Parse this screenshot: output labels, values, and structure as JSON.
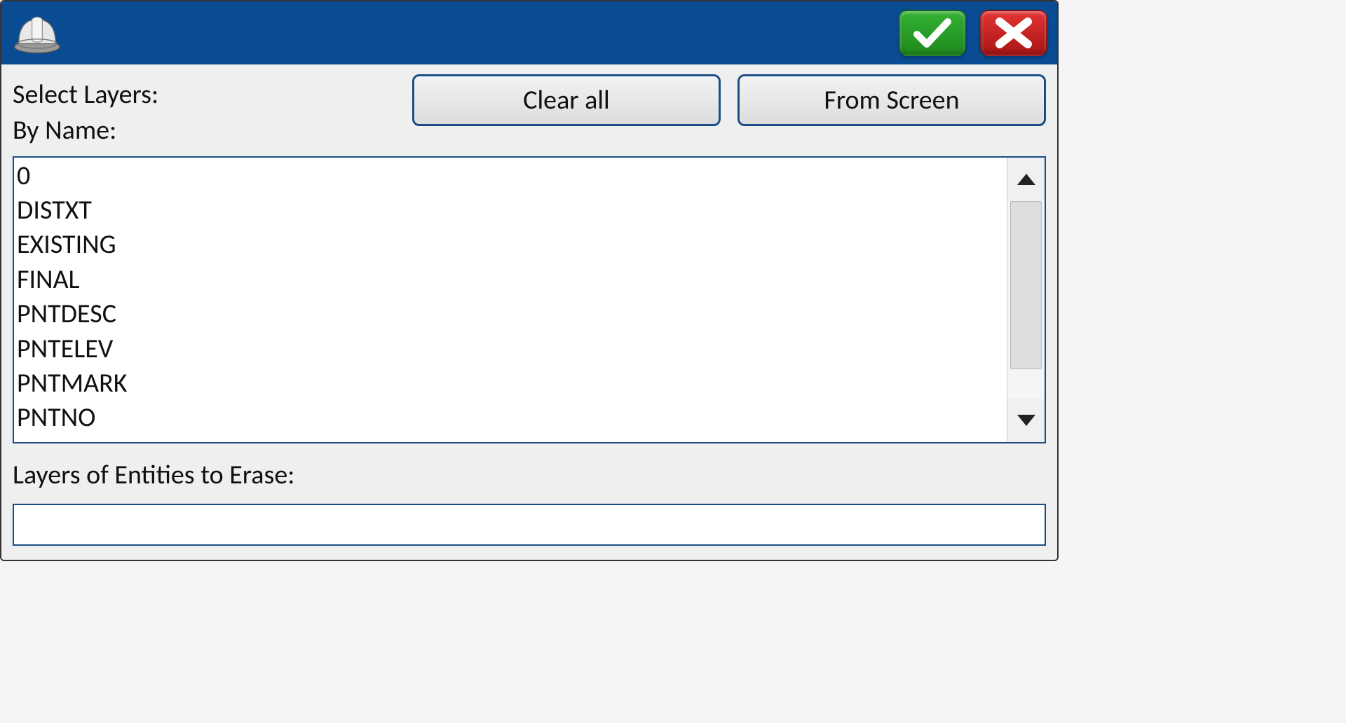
{
  "header": {
    "select_layers_label": "Select Layers:",
    "by_name_label": "By Name:",
    "clear_all_label": "Clear all",
    "from_screen_label": "From Screen"
  },
  "layers": {
    "items": [
      "0",
      "DISTXT",
      "EXISTING",
      "FINAL",
      "PNTDESC",
      "PNTELEV",
      "PNTMARK",
      "PNTNO"
    ]
  },
  "footer": {
    "layers_to_erase_label": "Layers of Entities to Erase:",
    "layers_to_erase_value": ""
  },
  "icons": {
    "app": "hardhat-icon",
    "ok": "checkmark-icon",
    "cancel": "x-icon",
    "scroll_up": "chevron-up-icon",
    "scroll_down": "chevron-down-icon"
  }
}
